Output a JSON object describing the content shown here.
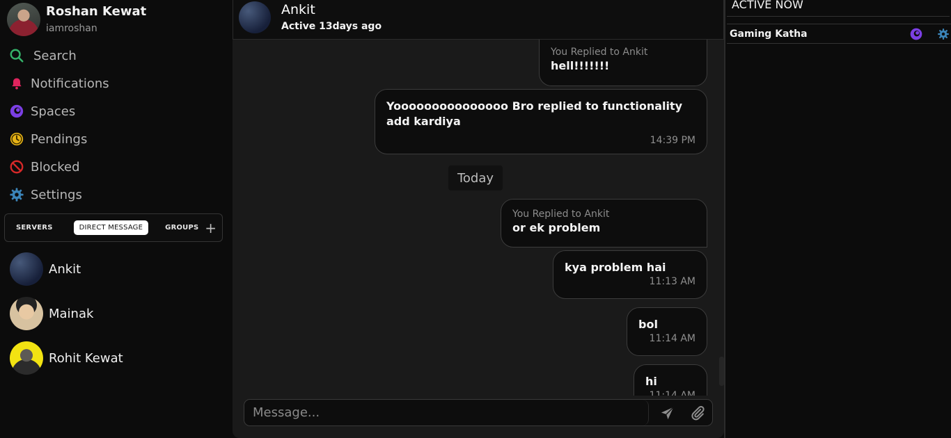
{
  "user": {
    "name": "Roshan Kewat",
    "handle": "iamroshan"
  },
  "nav": {
    "items": [
      {
        "label": "Search",
        "icon": "search-icon"
      },
      {
        "label": "Notifications",
        "icon": "bell-icon"
      },
      {
        "label": "Spaces",
        "icon": "space-icon"
      },
      {
        "label": "Pendings",
        "icon": "clock-icon"
      },
      {
        "label": "Blocked",
        "icon": "blocked-icon"
      },
      {
        "label": "Settings",
        "icon": "gear-icon"
      }
    ]
  },
  "tabs": {
    "servers": "SERVERS",
    "direct_message": "DIRECT MESSAGE",
    "groups": "GROUPS",
    "add": "+",
    "active": "direct_message"
  },
  "dms": [
    {
      "name": "Ankit"
    },
    {
      "name": "Mainak"
    },
    {
      "name": "Rohit Kewat"
    }
  ],
  "chat": {
    "name": "Ankit",
    "status": "Active 13days ago",
    "day_separator": "Today",
    "messages": [
      {
        "reply_label": "You Replied to Ankit",
        "text": "hell!!!!!!!"
      },
      {
        "text": "Yooooooooooooooo Bro replied to functionality add kardiya",
        "time": "14:39 PM"
      },
      {
        "reply_label": "You Replied to Ankit",
        "text": "or ek problem"
      },
      {
        "text": "kya problem hai",
        "time": "11:13 AM"
      },
      {
        "text": "bol",
        "time": "11:14 AM"
      },
      {
        "text": "hi",
        "time": "11:14 AM"
      }
    ],
    "composer": {
      "placeholder": "Message..."
    }
  },
  "active_now": {
    "title": "ACTIVE NOW",
    "items": [
      {
        "name": "Gaming Katha"
      }
    ]
  },
  "colors": {
    "background": "#0c0c0c",
    "chat_background": "#1a1a1a",
    "search_icon": "#35b36a",
    "bell_icon": "#e0245e",
    "space_icon": "#7b3fe4",
    "clock_icon": "#e7b416",
    "blocked_icon": "#d62828",
    "gear_icon": "#3b84b8"
  }
}
